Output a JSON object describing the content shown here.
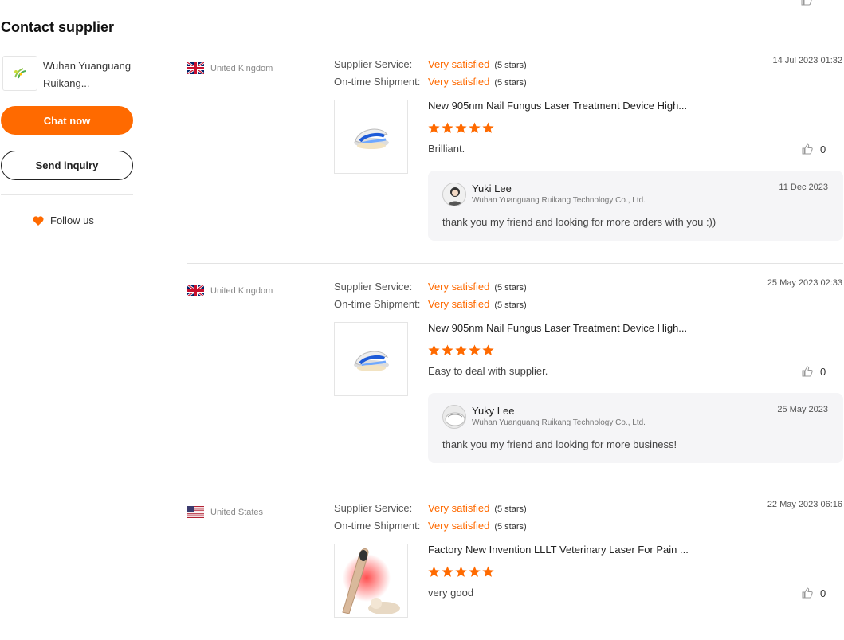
{
  "sidebar": {
    "title": "Contact supplier",
    "supplier_name": "Wuhan Yuanguang Ruikang...",
    "chat_label": "Chat now",
    "inquiry_label": "Send inquiry",
    "follow_label": "Follow us"
  },
  "colors": {
    "accent": "#ff6a00",
    "reply_bg": "#f5f5f7"
  },
  "reviews": [
    {
      "country": "United Kingdom",
      "flag": "uk-flag-icon",
      "service_label": "Supplier Service:",
      "service_value": "Very satisfied",
      "service_stars": "(5 stars)",
      "shipment_label": "On-time Shipment:",
      "shipment_value": "Very satisfied",
      "shipment_stars": "(5 stars)",
      "date": "14 Jul 2023 01:32",
      "product_title": "New 905nm Nail Fungus Laser Treatment Device High...",
      "rating": 5,
      "comment": "Brilliant.",
      "likes": "0",
      "reply": {
        "name": "Yuki Lee",
        "company": "Wuhan Yuanguang Ruikang Technology Co., Ltd.",
        "date": "11 Dec 2023",
        "text": "thank you my friend and looking for more orders with you :))"
      }
    },
    {
      "country": "United Kingdom",
      "flag": "uk-flag-icon",
      "service_label": "Supplier Service:",
      "service_value": "Very satisfied",
      "service_stars": "(5 stars)",
      "shipment_label": "On-time Shipment:",
      "shipment_value": "Very satisfied",
      "shipment_stars": "(5 stars)",
      "date": "25 May 2023 02:33",
      "product_title": "New 905nm Nail Fungus Laser Treatment Device High...",
      "rating": 5,
      "comment": "Easy to deal with supplier.",
      "likes": "0",
      "reply": {
        "name": "Yuky Lee",
        "company": "Wuhan Yuanguang Ruikang Technology Co., Ltd.",
        "date": "25 May 2023",
        "text": "thank you my friend and looking for more business!"
      }
    },
    {
      "country": "United States",
      "flag": "us-flag-icon",
      "service_label": "Supplier Service:",
      "service_value": "Very satisfied",
      "service_stars": "(5 stars)",
      "shipment_label": "On-time Shipment:",
      "shipment_value": "Very satisfied",
      "shipment_stars": "(5 stars)",
      "date": "22 May 2023 06:16",
      "product_title": "Factory New Invention LLLT Veterinary Laser For Pain ...",
      "rating": 5,
      "comment": "very good",
      "likes": "0"
    }
  ]
}
